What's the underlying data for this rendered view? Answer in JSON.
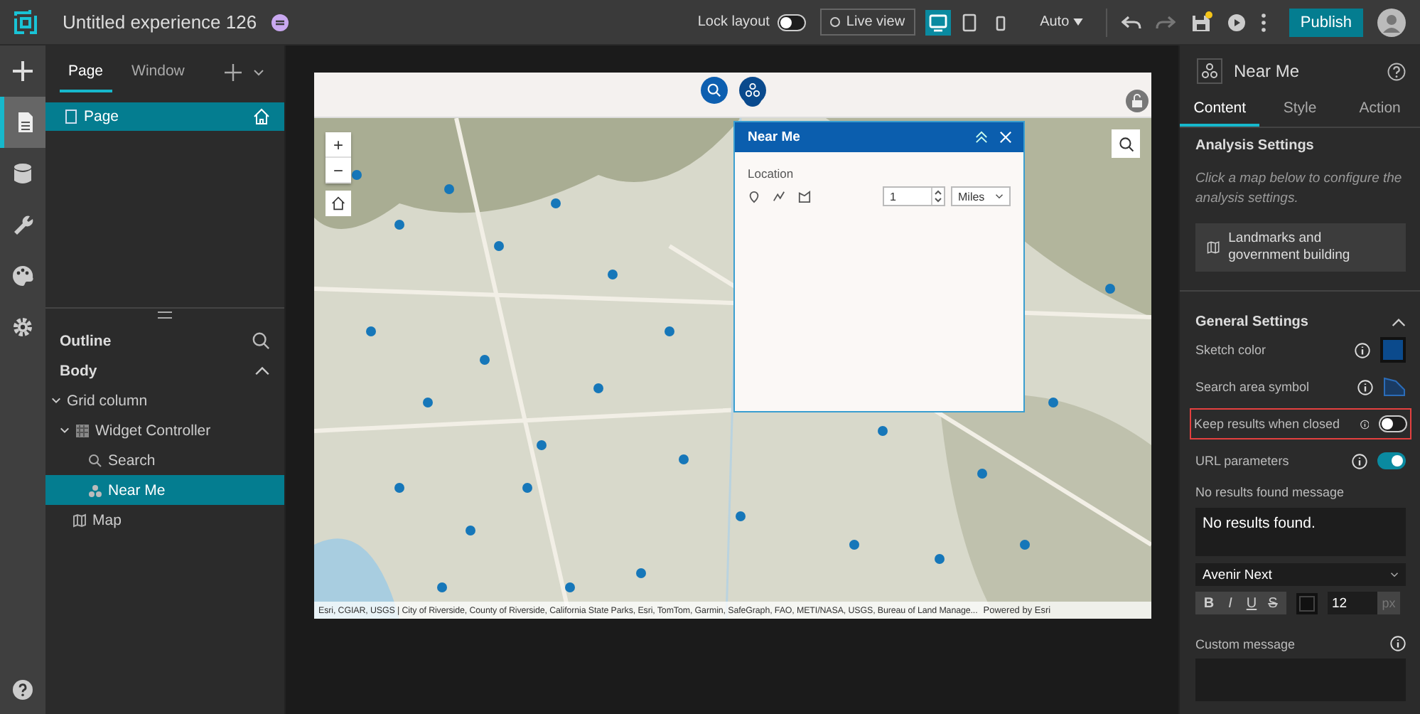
{
  "app": {
    "title": "Untitled experience 126"
  },
  "toolbar": {
    "lock_label": "Lock layout",
    "lock_on": false,
    "live_view": "Live view",
    "devices": [
      {
        "kind": "desktop",
        "selected": true
      },
      {
        "kind": "tablet",
        "selected": false
      },
      {
        "kind": "phone",
        "selected": false
      }
    ],
    "size": "Auto",
    "unsaved": true,
    "publish": "Publish"
  },
  "rail": [
    {
      "kind": "add",
      "selected": false
    },
    {
      "kind": "page",
      "selected": true
    },
    {
      "kind": "data",
      "selected": false
    },
    {
      "kind": "widget",
      "selected": false
    },
    {
      "kind": "theme",
      "selected": false
    },
    {
      "kind": "settings",
      "selected": false
    }
  ],
  "left_panel": {
    "tabs": [
      {
        "label": "Page",
        "selected": true
      },
      {
        "label": "Window",
        "selected": false
      }
    ],
    "pages": [
      {
        "label": "Page",
        "selected": true
      }
    ],
    "outline_title": "Outline",
    "body": "Body",
    "tree": [
      {
        "label": "Grid column",
        "expanded": true,
        "selected": false,
        "children": [
          {
            "label": "Widget Controller",
            "kind": "controller",
            "expanded": true,
            "selected": false,
            "children": [
              {
                "label": "Search",
                "kind": "search",
                "selected": false
              },
              {
                "label": "Near Me",
                "kind": "nearme",
                "selected": true
              }
            ]
          },
          {
            "label": "Map",
            "kind": "map",
            "selected": false
          }
        ]
      }
    ]
  },
  "canvas": {
    "widget_buttons": [
      {
        "kind": "search",
        "selected": false
      },
      {
        "kind": "nearme",
        "selected": true
      }
    ],
    "map": {
      "attribution": "Esri, CGIAR, USGS | City of Riverside, County of Riverside, California State Parks, Esri, TomTom, Garmin, SafeGraph, FAO, METI/NASA, USGS, Bureau of Land Manage...",
      "powered": "Powered by Esri",
      "zoom_in": "+",
      "zoom_out": "−"
    },
    "popup": {
      "title": "Near Me",
      "location_label": "Location",
      "distance": "1",
      "unit": "Miles"
    }
  },
  "right_panel": {
    "title": "Near Me",
    "tabs": [
      {
        "label": "Content",
        "selected": true
      },
      {
        "label": "Style",
        "selected": false
      },
      {
        "label": "Action",
        "selected": false
      }
    ],
    "analysis": {
      "title": "Analysis Settings",
      "hint": "Click a map below to configure the analysis settings.",
      "map_card": "Landmarks and government building"
    },
    "general": {
      "title": "General Settings",
      "expanded": true,
      "rows": [
        {
          "kind": "color",
          "label": "Sketch color",
          "color": "#0b4a8c",
          "highlighted": false
        },
        {
          "kind": "symbol",
          "label": "Search area symbol",
          "highlighted": false
        },
        {
          "kind": "toggle",
          "label": "Keep results when closed",
          "on": false,
          "highlighted": true
        },
        {
          "kind": "toggle",
          "label": "URL parameters",
          "on": true,
          "highlighted": false
        }
      ],
      "no_results_label": "No results found message",
      "no_results_text": "No results found.",
      "font": "Avenir Next",
      "format_buttons": [
        {
          "kind": "bold",
          "label": "B"
        },
        {
          "kind": "italic",
          "label": "I"
        },
        {
          "kind": "underline",
          "label": "U"
        },
        {
          "kind": "strike",
          "label": "S"
        }
      ],
      "font_size": "12",
      "size_unit": "px",
      "custom_label": "Custom message"
    }
  }
}
